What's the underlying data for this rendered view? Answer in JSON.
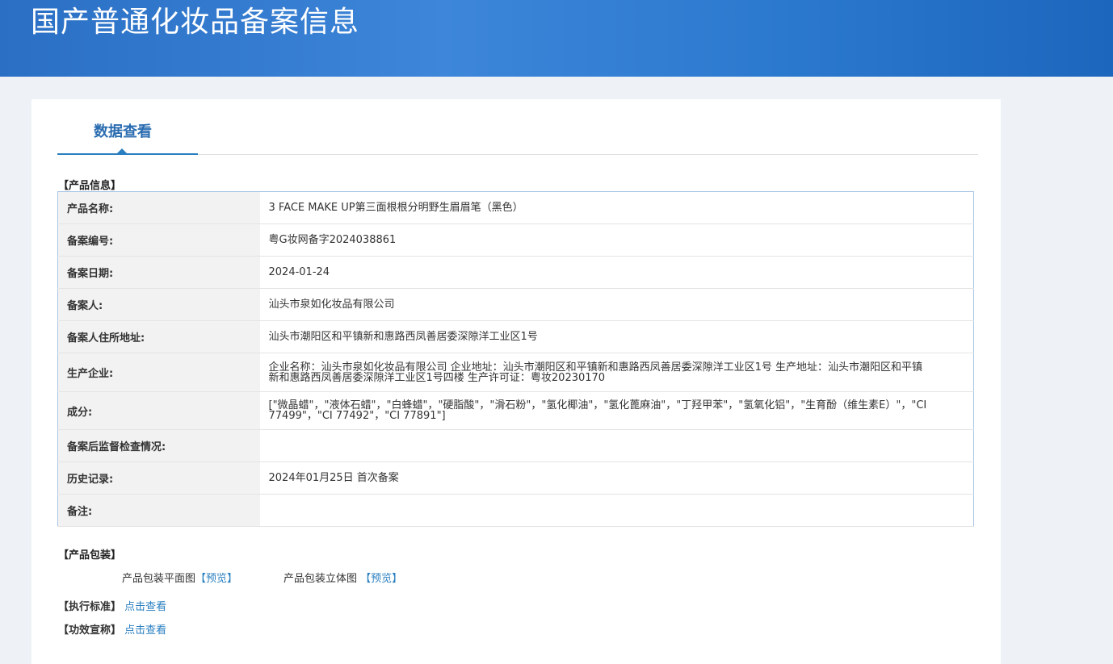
{
  "header": {
    "title": "国产普通化妆品备案信息"
  },
  "tab": {
    "label": "数据查看"
  },
  "product_info": {
    "section_title": "【产品信息】",
    "rows": [
      {
        "label": "产品名称:",
        "value": "3 FACE MAKE UP第三面根根分明野生眉眉笔（黑色）"
      },
      {
        "label": "备案编号:",
        "value": "粤G妆网备字2024038861"
      },
      {
        "label": "备案日期:",
        "value": "2024-01-24"
      },
      {
        "label": "备案人:",
        "value": "汕头市泉如化妆品有限公司"
      },
      {
        "label": "备案人住所地址:",
        "value": "汕头市潮阳区和平镇新和惠路西凤善居委深隙洋工业区1号"
      },
      {
        "label": "生产企业:",
        "value": "企业名称：汕头市泉如化妆品有限公司 企业地址：汕头市潮阳区和平镇新和惠路西凤善居委深隙洋工业区1号 生产地址：汕头市潮阳区和平镇新和惠路西凤善居委深隙洋工业区1号四楼 生产许可证：粤妆20230170"
      },
      {
        "label": "成分:",
        "value": "[\"微晶蜡\"，\"液体石蜡\"，\"白蜂蜡\"，\"硬脂酸\"，\"滑石粉\"，\"氢化椰油\"，\"氢化蓖麻油\"，\"丁羟甲苯\"，\"氢氧化铝\"，\"生育酚（维生素E）\"，\"CI 77499\"，\"CI 77492\"，\"CI 77891\"]"
      },
      {
        "label": "备案后监督检查情况:",
        "value": ""
      },
      {
        "label": "历史记录:",
        "value": "2024年01月25日 首次备案"
      },
      {
        "label": "备注:",
        "value": ""
      }
    ]
  },
  "packaging": {
    "section_title": "【产品包装】",
    "flat_label": "产品包装平面图",
    "flat_link": "【预览】",
    "solid_label": "产品包装立体图",
    "solid_link": "【预览】"
  },
  "standard": {
    "label": "【执行标准】",
    "link": "点击查看"
  },
  "efficacy": {
    "label": "【功效宣称】",
    "link": "点击查看"
  }
}
